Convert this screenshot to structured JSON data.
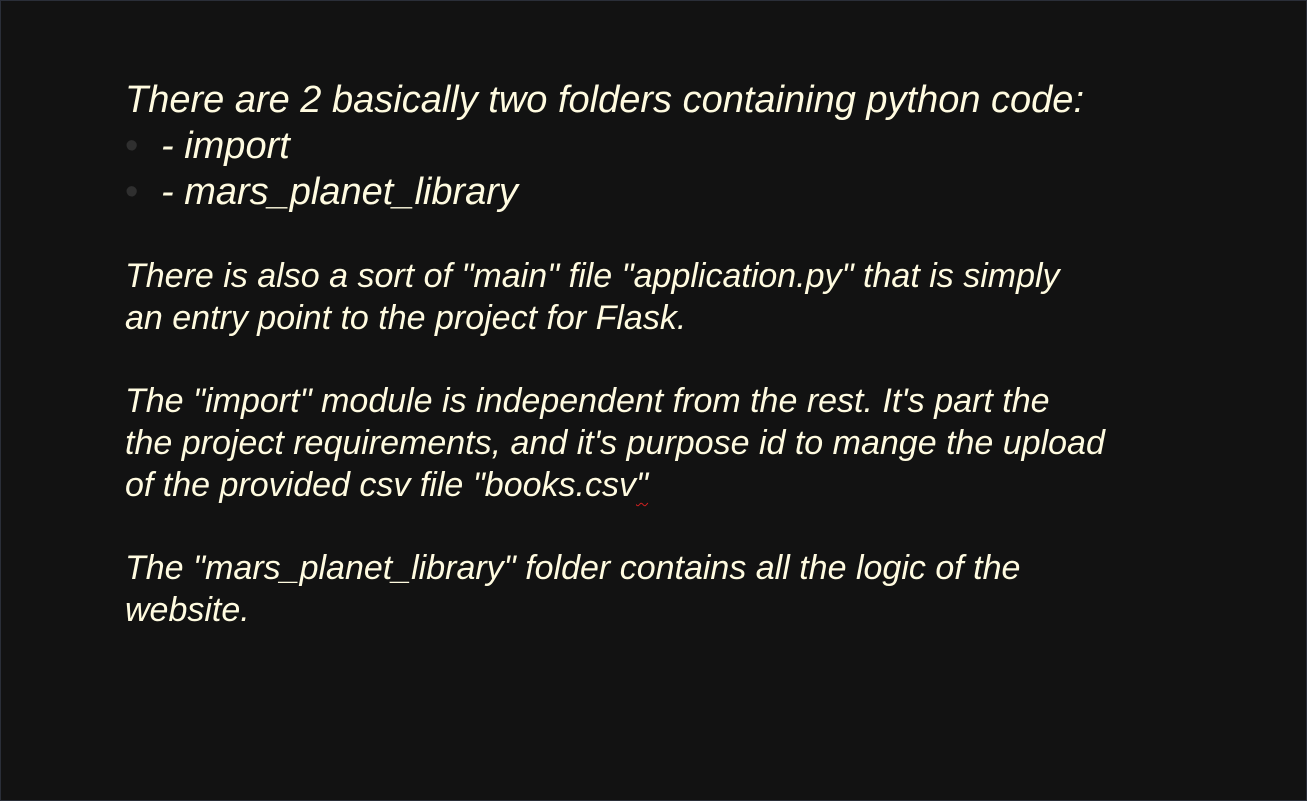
{
  "slide": {
    "heading": "There are 2 basically two folders containing python code:",
    "bullets": [
      "- import",
      "- mars_planet_library"
    ],
    "bullet_glyph": "•",
    "paragraphs": [
      {
        "lines": [
          "There is also a sort of \"main\" file \"application.py\" that is simply",
          "an entry point to the project for Flask."
        ]
      },
      {
        "lines": [
          "The \"import\" module is independent from the rest. It's part the",
          "the project requirements, and it's purpose id to mange the upload"
        ],
        "last_line_start": "of the provided csv file \"books.csv",
        "last_line_flagged": "\""
      },
      {
        "lines": [
          "The \"mars_planet_library\" folder contains all the logic of the",
          "website."
        ]
      }
    ]
  },
  "colors": {
    "background": "#121212",
    "text": "#fffbe0",
    "spellcheck_underline": "#d02020"
  }
}
